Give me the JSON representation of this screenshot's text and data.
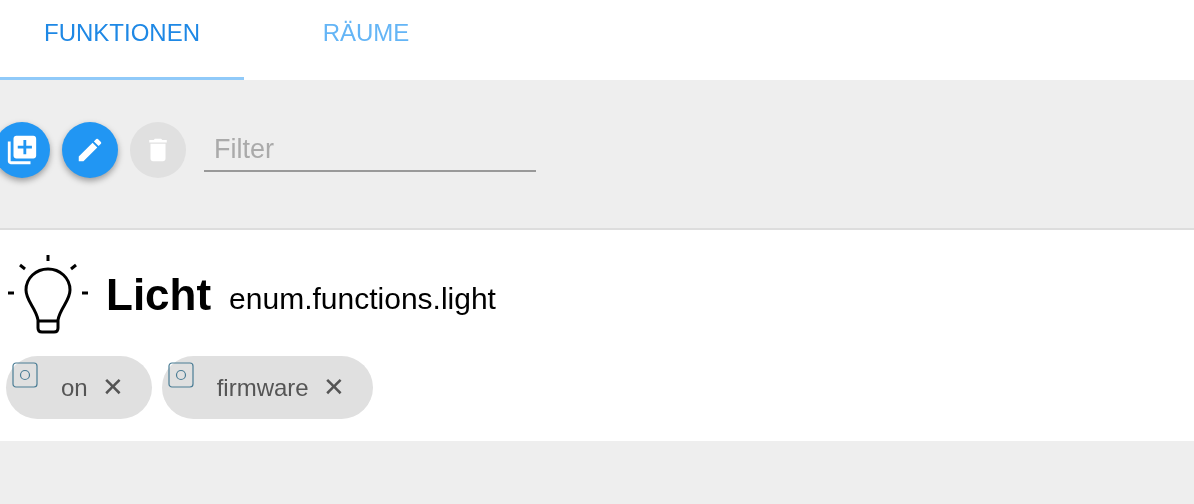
{
  "tabs": [
    {
      "label": "FUNKTIONEN",
      "selected": true
    },
    {
      "label": "RÄUME",
      "selected": false
    }
  ],
  "toolbar": {
    "buttons": [
      {
        "kind": "add",
        "disabled": false
      },
      {
        "kind": "edit",
        "disabled": false
      },
      {
        "kind": "delete",
        "disabled": true
      }
    ],
    "filter": {
      "placeholder": "Filter"
    }
  },
  "enum": {
    "name": "Licht",
    "id": "enum.functions.light",
    "members": [
      {
        "label": "on",
        "close": "✕"
      },
      {
        "label": "firmware",
        "close": "✕"
      }
    ]
  }
}
